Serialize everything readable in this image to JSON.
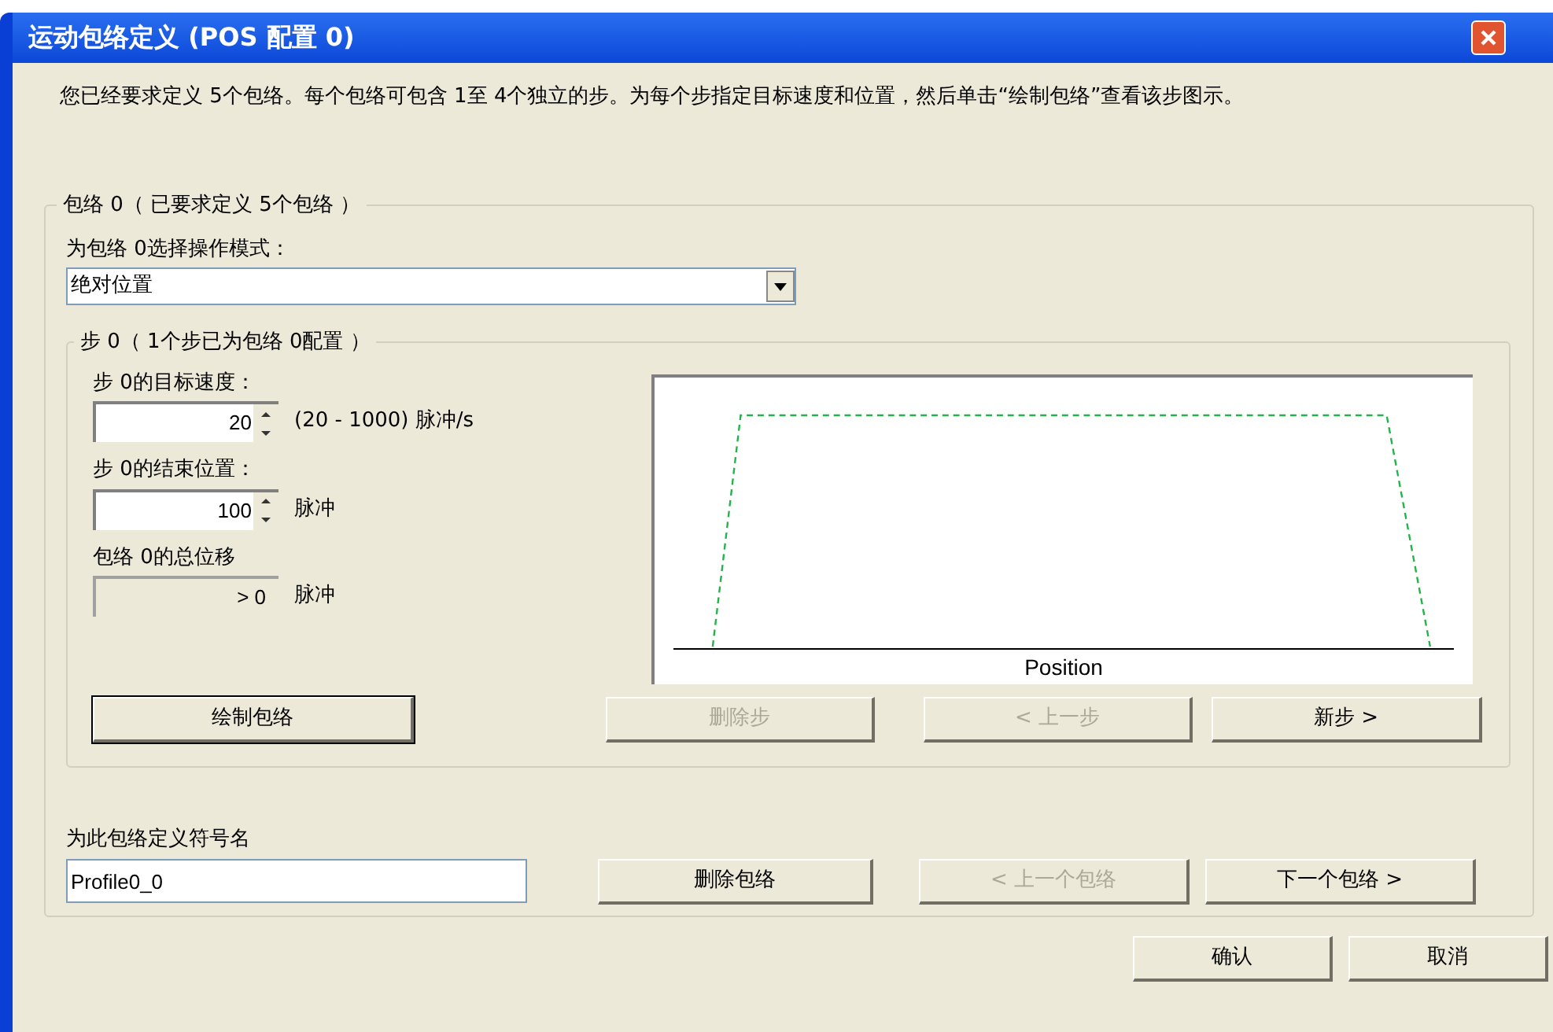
{
  "window": {
    "title": "运动包络定义 (POS 配置 0)"
  },
  "description": "您已经要求定义 5个包络。每个包络可包含 1至 4个独立的步。为每个步指定目标速度和位置，然后单击“绘制包络”查看该步图示。",
  "profile_group": {
    "title": "包络 0（ 已要求定义 5个包络 ）",
    "mode_label": "为包络 0选择操作模式：",
    "mode_value": "绝对位置",
    "step_group": {
      "title": "步 0（ 1个步已为包络 0配置 ）",
      "fields": [
        {
          "kind": "spinner",
          "label": "步 0的目标速度：",
          "value": "20",
          "unit": "(20 - 1000) 脉冲/s"
        },
        {
          "kind": "spinner",
          "label": "步 0的结束位置：",
          "value": "100",
          "unit": "脉冲"
        },
        {
          "kind": "readonly",
          "label": "包络 0的总位移",
          "value": "> 0",
          "unit": "脉冲"
        }
      ],
      "chart": {
        "xlabel": "Position"
      },
      "buttons": [
        {
          "label": "绘制包络",
          "disabled": false,
          "default": true
        },
        {
          "label": "删除步",
          "disabled": true,
          "default": false
        },
        {
          "label": "< 上一步",
          "disabled": true,
          "default": false
        },
        {
          "label": "新步 >",
          "disabled": false,
          "default": false
        }
      ]
    },
    "symbol_label": "为此包络定义符号名",
    "symbol_value": "Profile0_0",
    "buttons": [
      {
        "label": "删除包络",
        "disabled": false
      },
      {
        "label": "< 上一个包络",
        "disabled": true
      },
      {
        "label": "下一个包络 >",
        "disabled": false
      }
    ]
  },
  "footer_buttons": [
    {
      "label": "确认"
    },
    {
      "label": "取消"
    }
  ]
}
